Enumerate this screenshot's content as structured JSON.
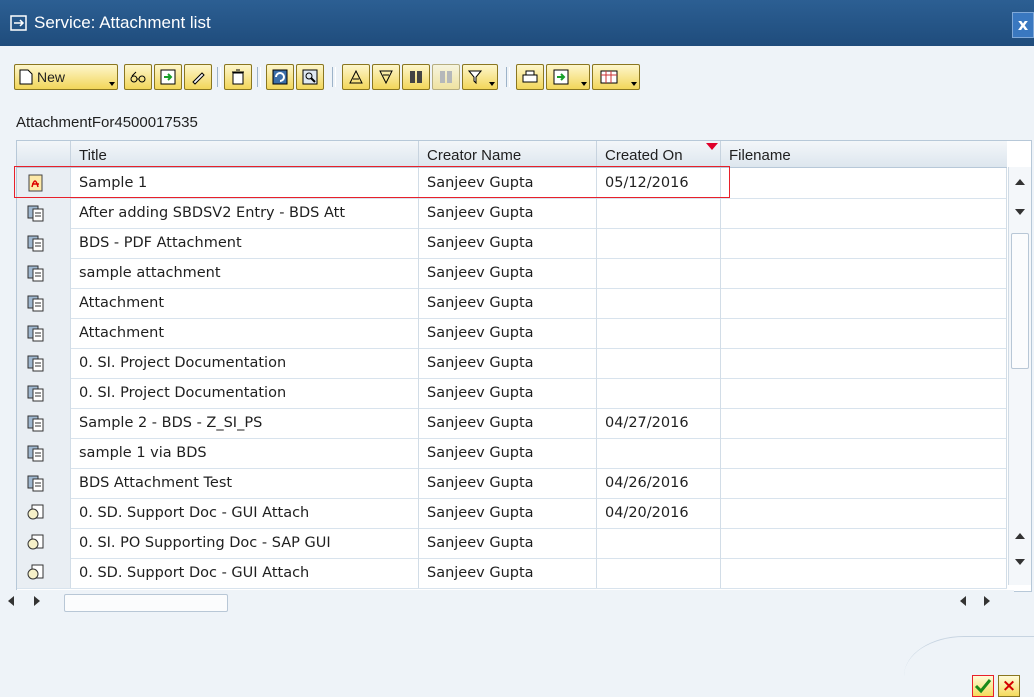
{
  "window": {
    "title": "Service: Attachment list",
    "close_label": "x"
  },
  "toolbar": {
    "new_label": "New"
  },
  "caption": "AttachmentFor4500017535",
  "columns": [
    "Title",
    "Creator Name",
    "Created On",
    "Filename"
  ],
  "sort_column": "Created On",
  "rows": [
    {
      "icon": "pdf-icon",
      "title": "Sample 1",
      "creator": "Sanjeev Gupta",
      "created": "05/12/2016",
      "file": ""
    },
    {
      "icon": "document-icon",
      "title": "After adding SBDSV2 Entry - BDS Att",
      "creator": "Sanjeev Gupta",
      "created": "",
      "file": ""
    },
    {
      "icon": "document-icon",
      "title": "BDS - PDF Attachment",
      "creator": "Sanjeev Gupta",
      "created": "",
      "file": ""
    },
    {
      "icon": "document-icon",
      "title": "sample attachment",
      "creator": "Sanjeev Gupta",
      "created": "",
      "file": ""
    },
    {
      "icon": "document-icon",
      "title": "Attachment",
      "creator": "Sanjeev Gupta",
      "created": "",
      "file": ""
    },
    {
      "icon": "document-icon",
      "title": "Attachment",
      "creator": "Sanjeev Gupta",
      "created": "",
      "file": ""
    },
    {
      "icon": "document-icon",
      "title": "0. SI. Project Documentation",
      "creator": "Sanjeev Gupta",
      "created": "",
      "file": ""
    },
    {
      "icon": "document-icon",
      "title": "0. SI. Project Documentation",
      "creator": "Sanjeev Gupta",
      "created": "",
      "file": ""
    },
    {
      "icon": "document-icon",
      "title": "Sample 2 - BDS - Z_SI_PS",
      "creator": "Sanjeev Gupta",
      "created": "04/27/2016",
      "file": ""
    },
    {
      "icon": "document-icon",
      "title": "sample 1 via BDS",
      "creator": "Sanjeev Gupta",
      "created": "",
      "file": ""
    },
    {
      "icon": "document-icon",
      "title": "BDS Attachment Test",
      "creator": "Sanjeev Gupta",
      "created": "04/26/2016",
      "file": ""
    },
    {
      "icon": "attachment-icon",
      "title": "0. SD. Support Doc - GUI Attach",
      "creator": "Sanjeev Gupta",
      "created": "04/20/2016",
      "file": ""
    },
    {
      "icon": "attachment-icon",
      "title": "0. SI. PO Supporting Doc - SAP GUI",
      "creator": "Sanjeev Gupta",
      "created": "",
      "file": ""
    },
    {
      "icon": "attachment-icon",
      "title": "0. SD. Support Doc - GUI Attach",
      "creator": "Sanjeev Gupta",
      "created": "",
      "file": ""
    }
  ],
  "footer": {
    "ok_icon": "checkmark-icon",
    "cancel_icon": "cancel-icon",
    "cancel_label": "×"
  },
  "colors": {
    "titlebar": "#1f4c7c",
    "button_gold": "#f2d65a",
    "highlight_red": "#e8202a"
  }
}
